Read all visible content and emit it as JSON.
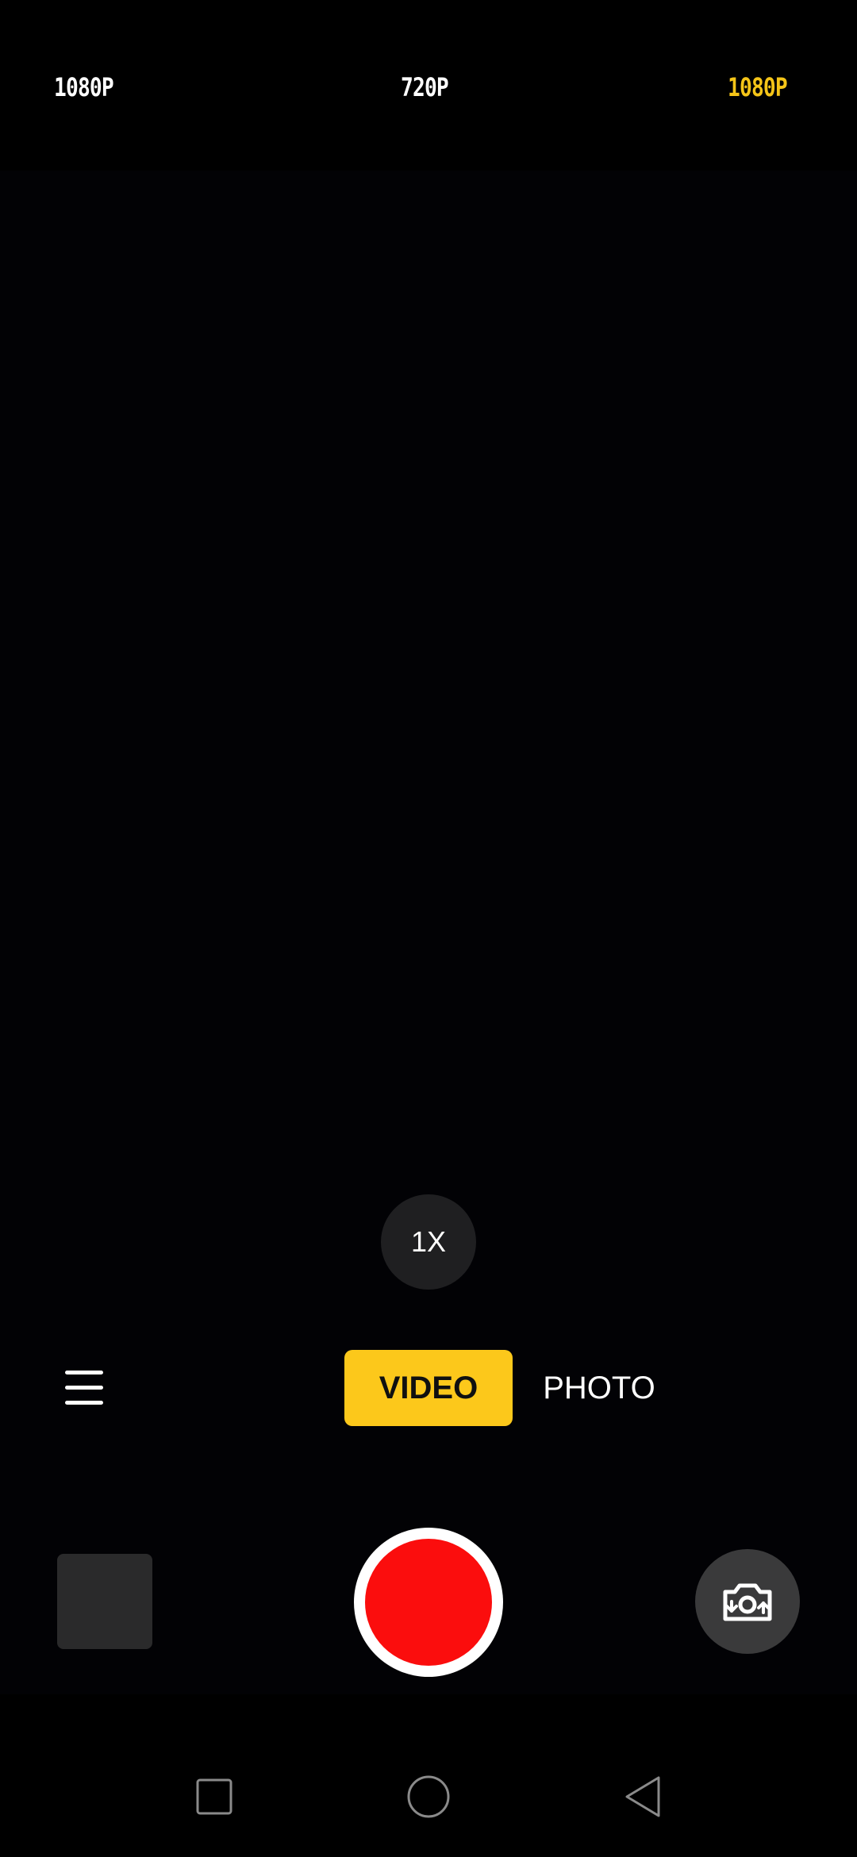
{
  "resolution_bar": {
    "left_label": "1080P",
    "middle_label": "720P",
    "right_label": "1080P",
    "active_color": "#f5c518"
  },
  "zoom": {
    "label": "1X"
  },
  "modes": {
    "video_label": "VIDEO",
    "photo_label": "PHOTO",
    "active_mode": "VIDEO",
    "active_color": "#fcc81b"
  },
  "controls": {
    "menu_icon": "hamburger-menu-icon",
    "record_color": "#fb0d0d",
    "flip_icon": "camera-flip-icon"
  },
  "nav": {
    "recent_icon": "square-icon",
    "home_icon": "circle-icon",
    "back_icon": "triangle-back-icon"
  }
}
